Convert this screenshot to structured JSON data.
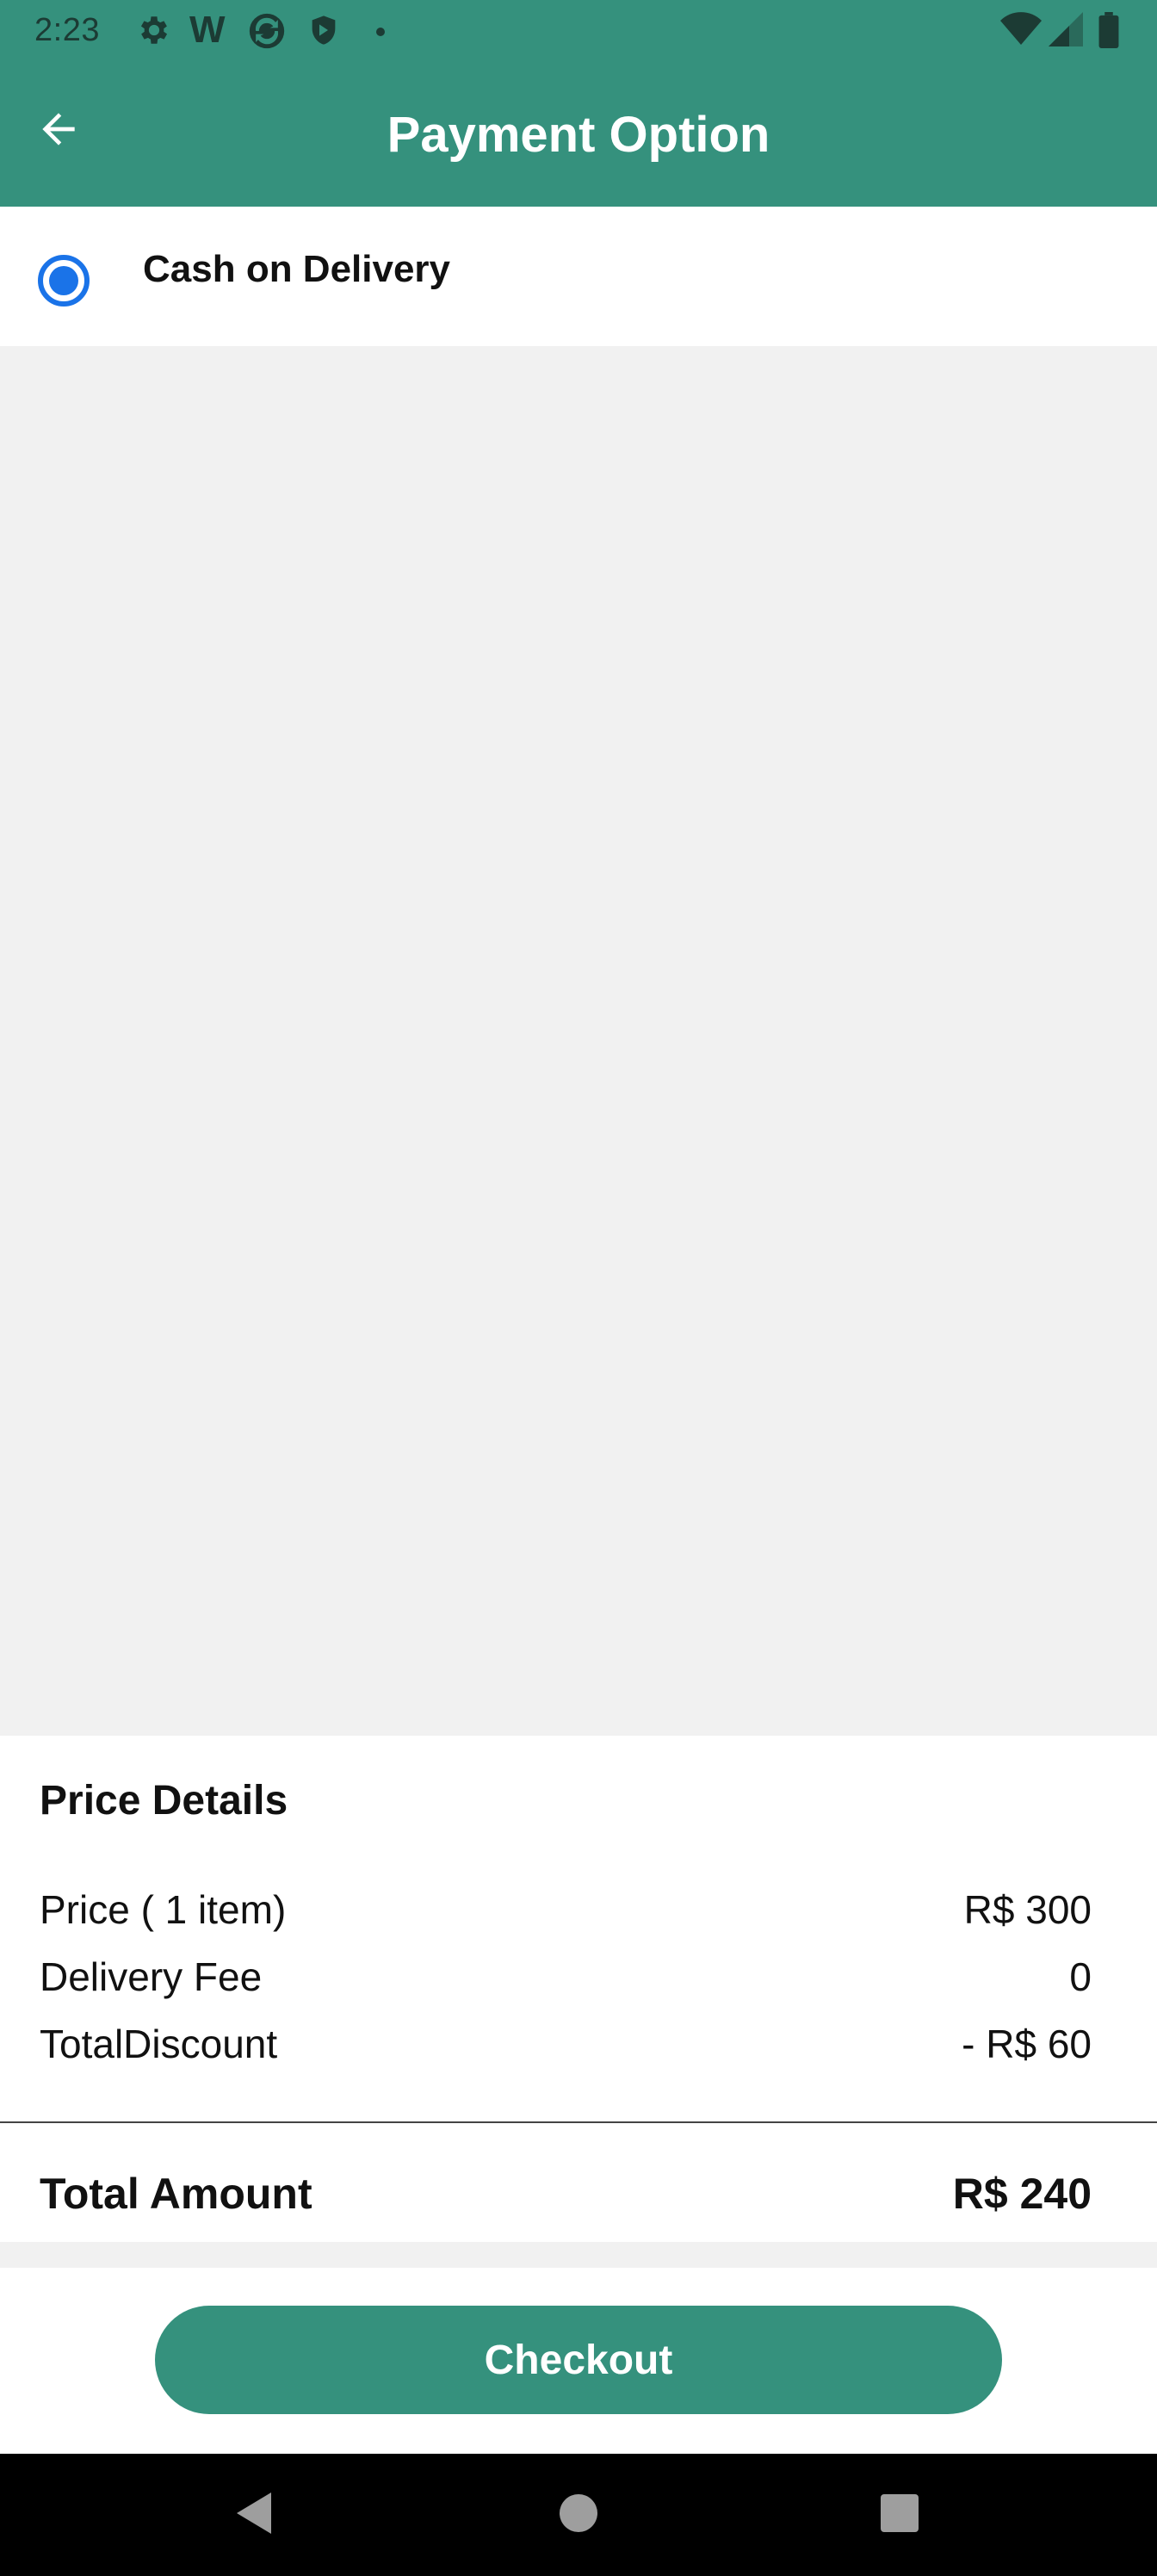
{
  "status_bar": {
    "time": "2:23",
    "icons": [
      "settings-icon",
      "wikipedia-icon",
      "sync-icon",
      "shield-icon",
      "dot-icon",
      "wifi-icon",
      "signal-icon",
      "battery-icon"
    ]
  },
  "app_bar": {
    "title": "Payment Option",
    "back_icon": "arrow-left-icon"
  },
  "payment_options": [
    {
      "label": "Cash on Delivery",
      "selected": true
    }
  ],
  "price_details": {
    "heading": "Price Details",
    "rows": [
      {
        "label": "Price ( 1 item)",
        "value": "R$ 300"
      },
      {
        "label": "Delivery Fee",
        "value": "0"
      },
      {
        "label": "TotalDiscount",
        "value": "- R$ 60"
      }
    ],
    "total_label": "Total Amount",
    "total_value": "R$ 240"
  },
  "checkout": {
    "label": "Checkout"
  },
  "nav_bar": {
    "icons": [
      "back-triangle-icon",
      "home-circle-icon",
      "recents-square-icon"
    ]
  },
  "colors": {
    "primary": "#35917d",
    "radio": "#1a73e8",
    "background": "#f1f1f1"
  }
}
